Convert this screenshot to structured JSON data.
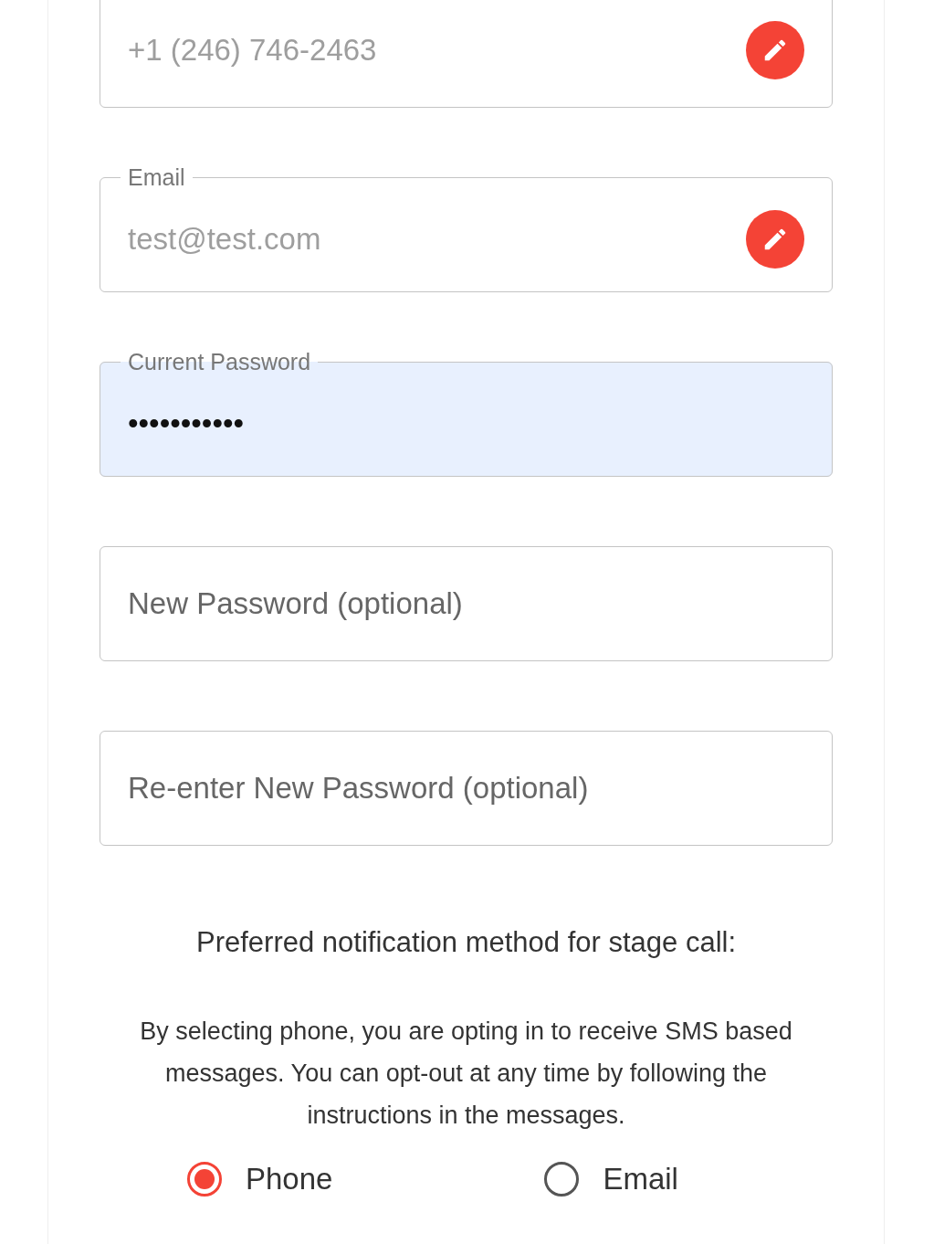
{
  "fields": [
    {
      "kind": "value",
      "value": "+1 (246) 746-2463",
      "disabled": true,
      "autofilled": false,
      "editable": true
    },
    {
      "kind": "value",
      "label": "Email",
      "value": "test@test.com",
      "disabled": true,
      "autofilled": false,
      "editable": true
    },
    {
      "kind": "value",
      "label": "Current Password",
      "value": "•••••••••••",
      "disabled": false,
      "autofilled": true,
      "editable": false
    },
    {
      "kind": "empty",
      "placeholder": "New Password (optional)",
      "disabled": false,
      "autofilled": false,
      "editable": false
    },
    {
      "kind": "empty",
      "placeholder": "Re-enter New Password (optional)",
      "disabled": false,
      "autofilled": false,
      "editable": false
    }
  ],
  "notification": {
    "heading": "Preferred notification method for stage call:",
    "note": "By selecting phone, you are opting in to receive SMS based messages. You can opt-out at any time by following the instructions in the messages.",
    "options": [
      {
        "label": "Phone",
        "selected": true
      },
      {
        "label": "Email",
        "selected": false
      }
    ]
  }
}
